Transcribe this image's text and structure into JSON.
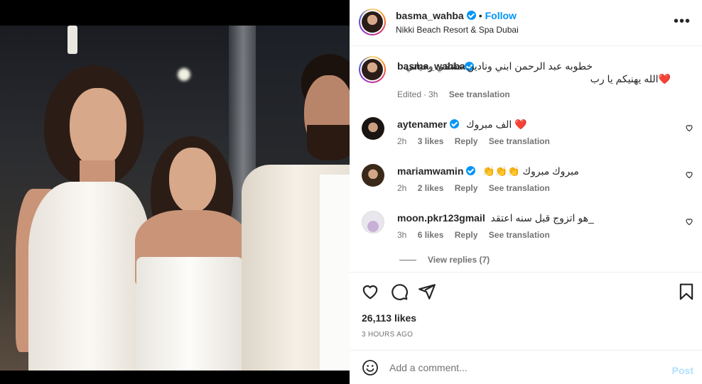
{
  "post": {
    "username": "basma_wahba",
    "follow_label": "Follow",
    "separator": "•",
    "location": "Nikki Beach Resort & Spa Dubai",
    "more_label": "•••"
  },
  "caption": {
    "username": "basma_wahba",
    "text": "خطوبه عبد الرحمن ابني ونادين عشقي وحياتي❤️الله يهنيكم يا رب",
    "edited": "Edited",
    "age": "3h",
    "see_translation": "See translation"
  },
  "comments": [
    {
      "username": "aytenamer",
      "verified": true,
      "text": "❤️ الف مبروك",
      "age": "2h",
      "likes": "3 likes",
      "reply": "Reply",
      "see_translation": "See translation"
    },
    {
      "username": "mariamwamin",
      "verified": true,
      "text": "مبروك مبروك 👏👏👏",
      "age": "2h",
      "likes": "2 likes",
      "reply": "Reply",
      "see_translation": "See translation"
    },
    {
      "username": "moon.pkr123gmail",
      "verified": false,
      "text": "_هو اتزوج قبل سنه اعتقد",
      "age": "3h",
      "likes": "6 likes",
      "reply": "Reply",
      "see_translation": "See translation"
    }
  ],
  "view_replies": "View replies (7)",
  "likes_count": "26,113 likes",
  "posted_time": "3 HOURS AGO",
  "composer": {
    "placeholder": "Add a comment...",
    "post_label": "Post"
  },
  "colors": {
    "accent": "#0095f6",
    "post_disabled": "#b2dffc",
    "secondary_text": "#737373"
  },
  "icons": [
    "heart-icon",
    "comment-icon",
    "share-icon",
    "bookmark-icon",
    "emoji-icon",
    "more-options-icon",
    "verified-badge-icon"
  ]
}
